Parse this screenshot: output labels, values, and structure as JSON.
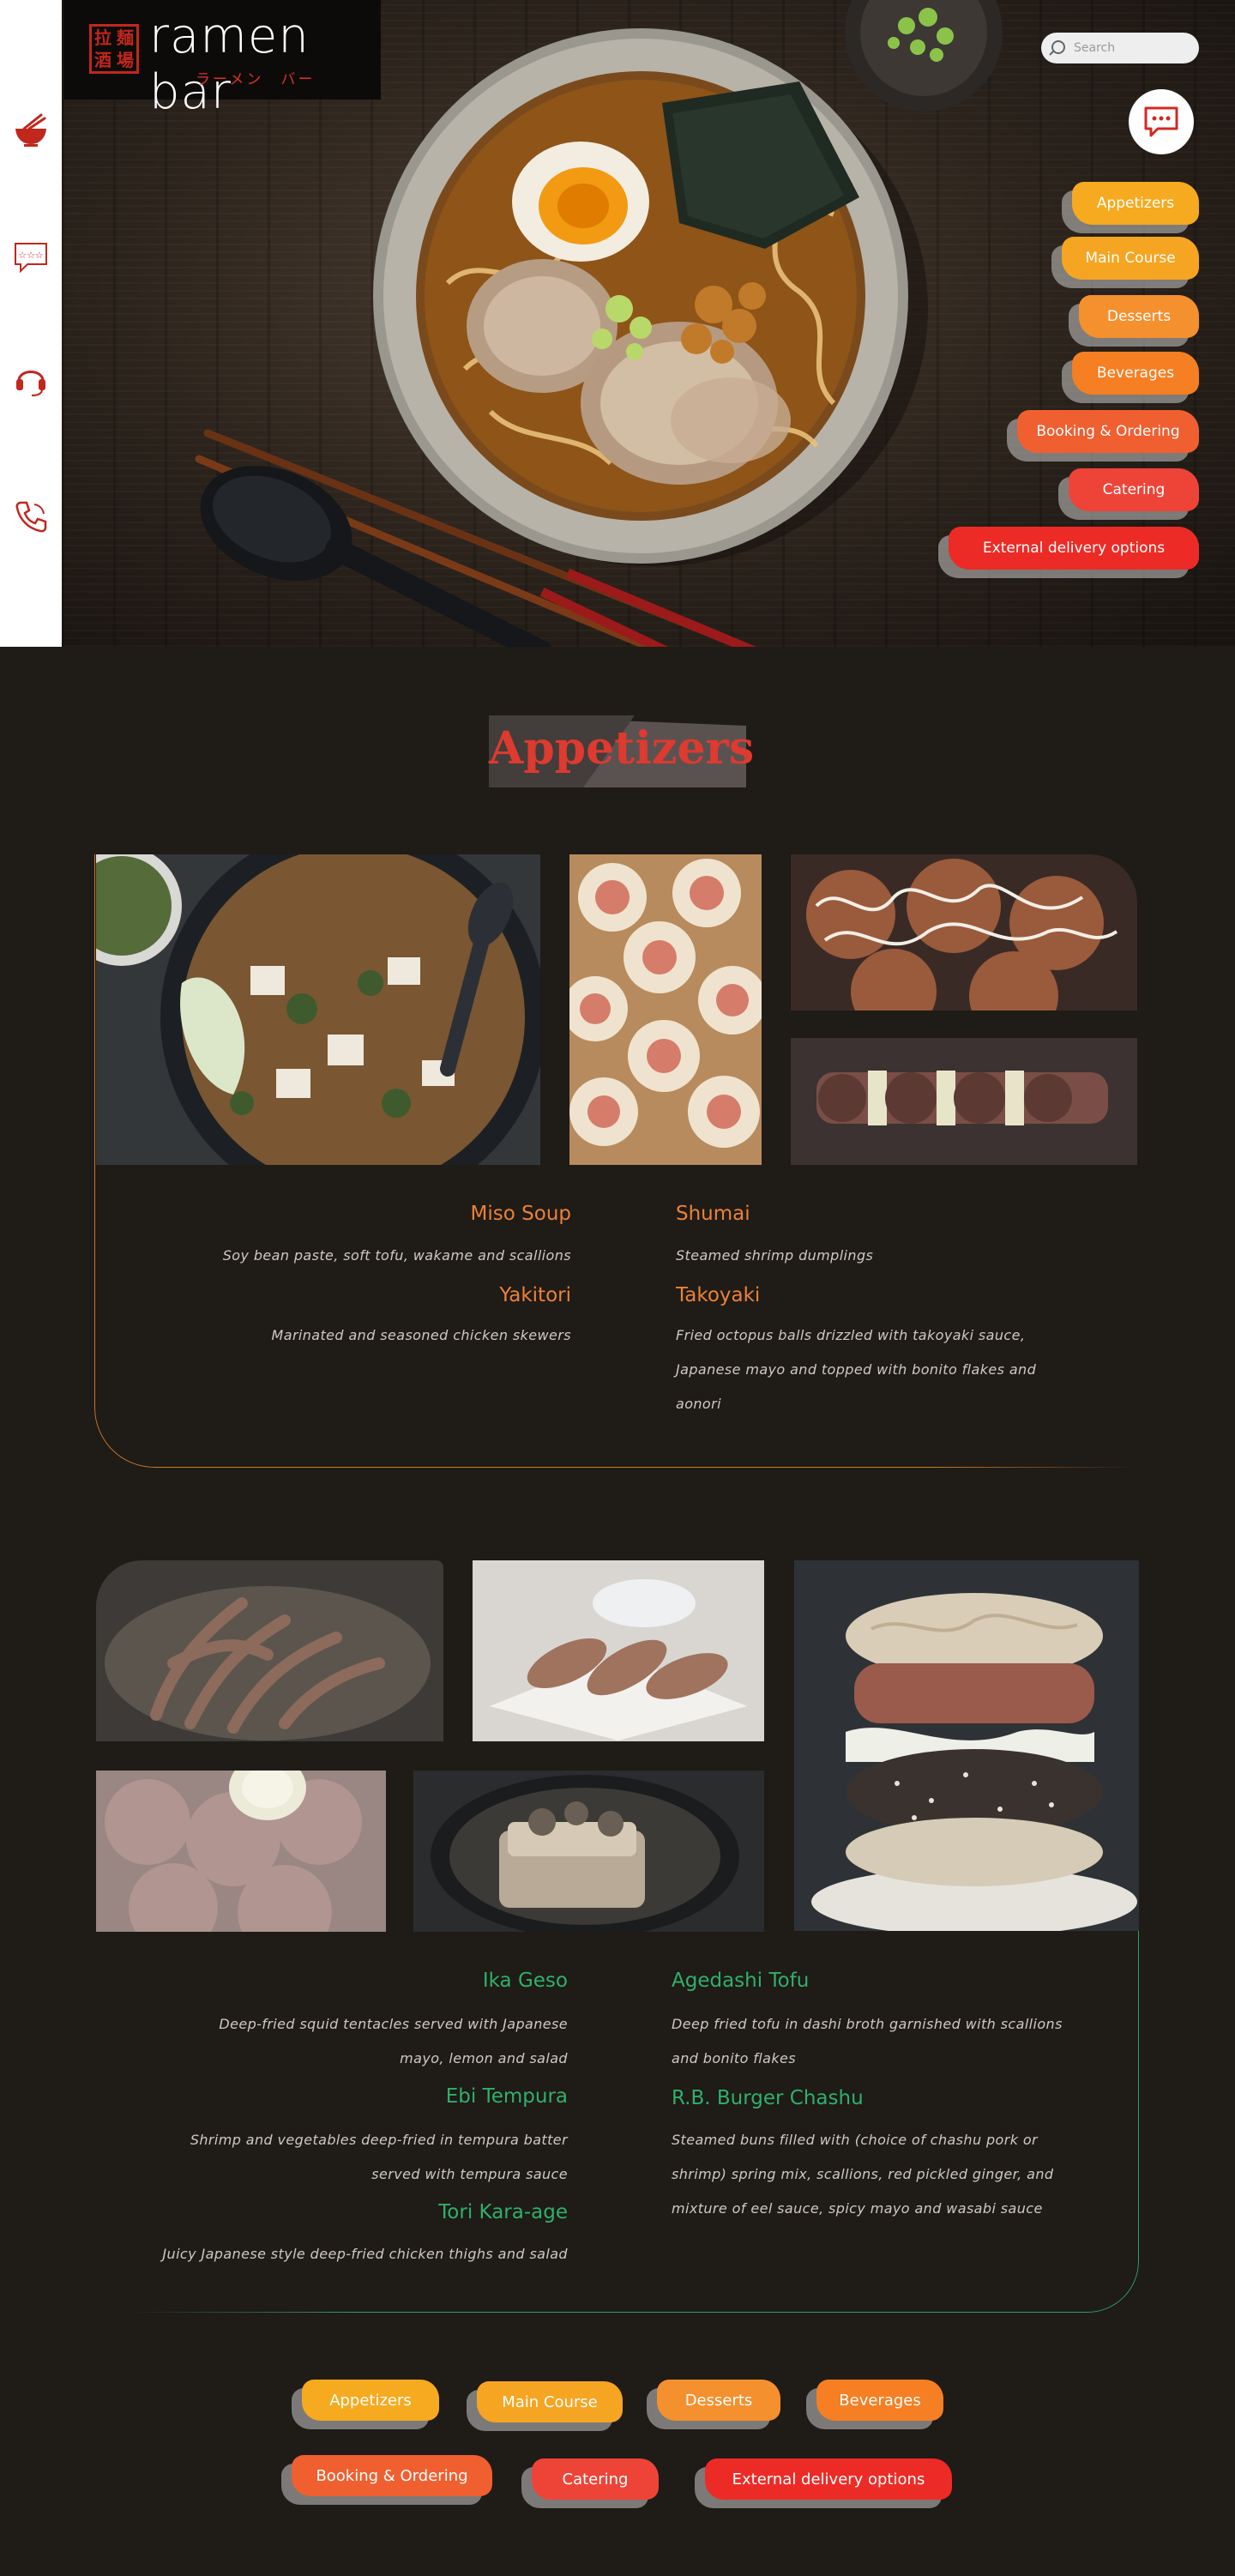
{
  "brand": {
    "name": "ramen bar",
    "subtitle": "ラーメン　バー",
    "seal_chars": [
      "拉",
      "麺",
      "酒",
      "場"
    ],
    "accent": "#c0271d"
  },
  "rail": {
    "icons": [
      "ramen-bowl-icon",
      "review-stars-icon",
      "headset-icon",
      "phone-icon"
    ]
  },
  "search": {
    "placeholder": "Search"
  },
  "hero_nav": [
    {
      "label": "Appetizers",
      "color": "#f6aa1f"
    },
    {
      "label": "Main Course",
      "color": "#f6a522"
    },
    {
      "label": "Desserts",
      "color": "#f5902f"
    },
    {
      "label": "Beverages",
      "color": "#f57f22"
    },
    {
      "label": "Booking & Ordering",
      "color": "#f05f30"
    },
    {
      "label": "Catering",
      "color": "#ee4438"
    },
    {
      "label": "External delivery options",
      "color": "#ed2b26"
    }
  ],
  "section": {
    "title": "Appetizers"
  },
  "group_a": {
    "items": [
      {
        "name": "Miso Soup",
        "desc": "Soy bean paste, soft tofu, wakame and scallions"
      },
      {
        "name": "Yakitori",
        "desc": "Marinated and seasoned chicken skewers"
      },
      {
        "name": "Shumai",
        "desc": "Steamed shrimp dumplings"
      },
      {
        "name": "Takoyaki",
        "desc_lines": [
          "Fried octopus balls drizzled with takoyaki sauce,",
          "Japanese mayo and topped with bonito flakes and",
          "aonori"
        ]
      }
    ]
  },
  "group_b": {
    "items": [
      {
        "name": "Ika Geso",
        "desc_lines": [
          "Deep-fried squid tentacles served with Japanese",
          "mayo, lemon and salad"
        ]
      },
      {
        "name": "Ebi Tempura",
        "desc_lines": [
          "Shrimp and vegetables deep-fried in tempura batter",
          "served with tempura sauce"
        ]
      },
      {
        "name": "Tori Kara-age",
        "desc": "Juicy Japanese style deep-fried chicken thighs and salad"
      },
      {
        "name": "Agedashi Tofu",
        "desc_lines": [
          "Deep fried tofu in dashi broth garnished with scallions",
          "and bonito flakes"
        ]
      },
      {
        "name": "R.B. Burger Chashu",
        "desc_lines": [
          "Steamed buns filled with (choice of chashu pork or",
          "shrimp) spring mix, scallions, red pickled ginger, and",
          "mixture of eel sauce, spicy mayo and wasabi sauce"
        ]
      }
    ]
  },
  "bottom_nav": [
    {
      "label": "Appetizers",
      "color": "#f6aa1f"
    },
    {
      "label": "Main Course",
      "color": "#f6a522"
    },
    {
      "label": "Desserts",
      "color": "#f5902f"
    },
    {
      "label": "Beverages",
      "color": "#f57f22"
    },
    {
      "label": "Booking & Ordering",
      "color": "#f05f30"
    },
    {
      "label": "Catering",
      "color": "#ee4438"
    },
    {
      "label": "External delivery options",
      "color": "#ed2b26"
    }
  ]
}
